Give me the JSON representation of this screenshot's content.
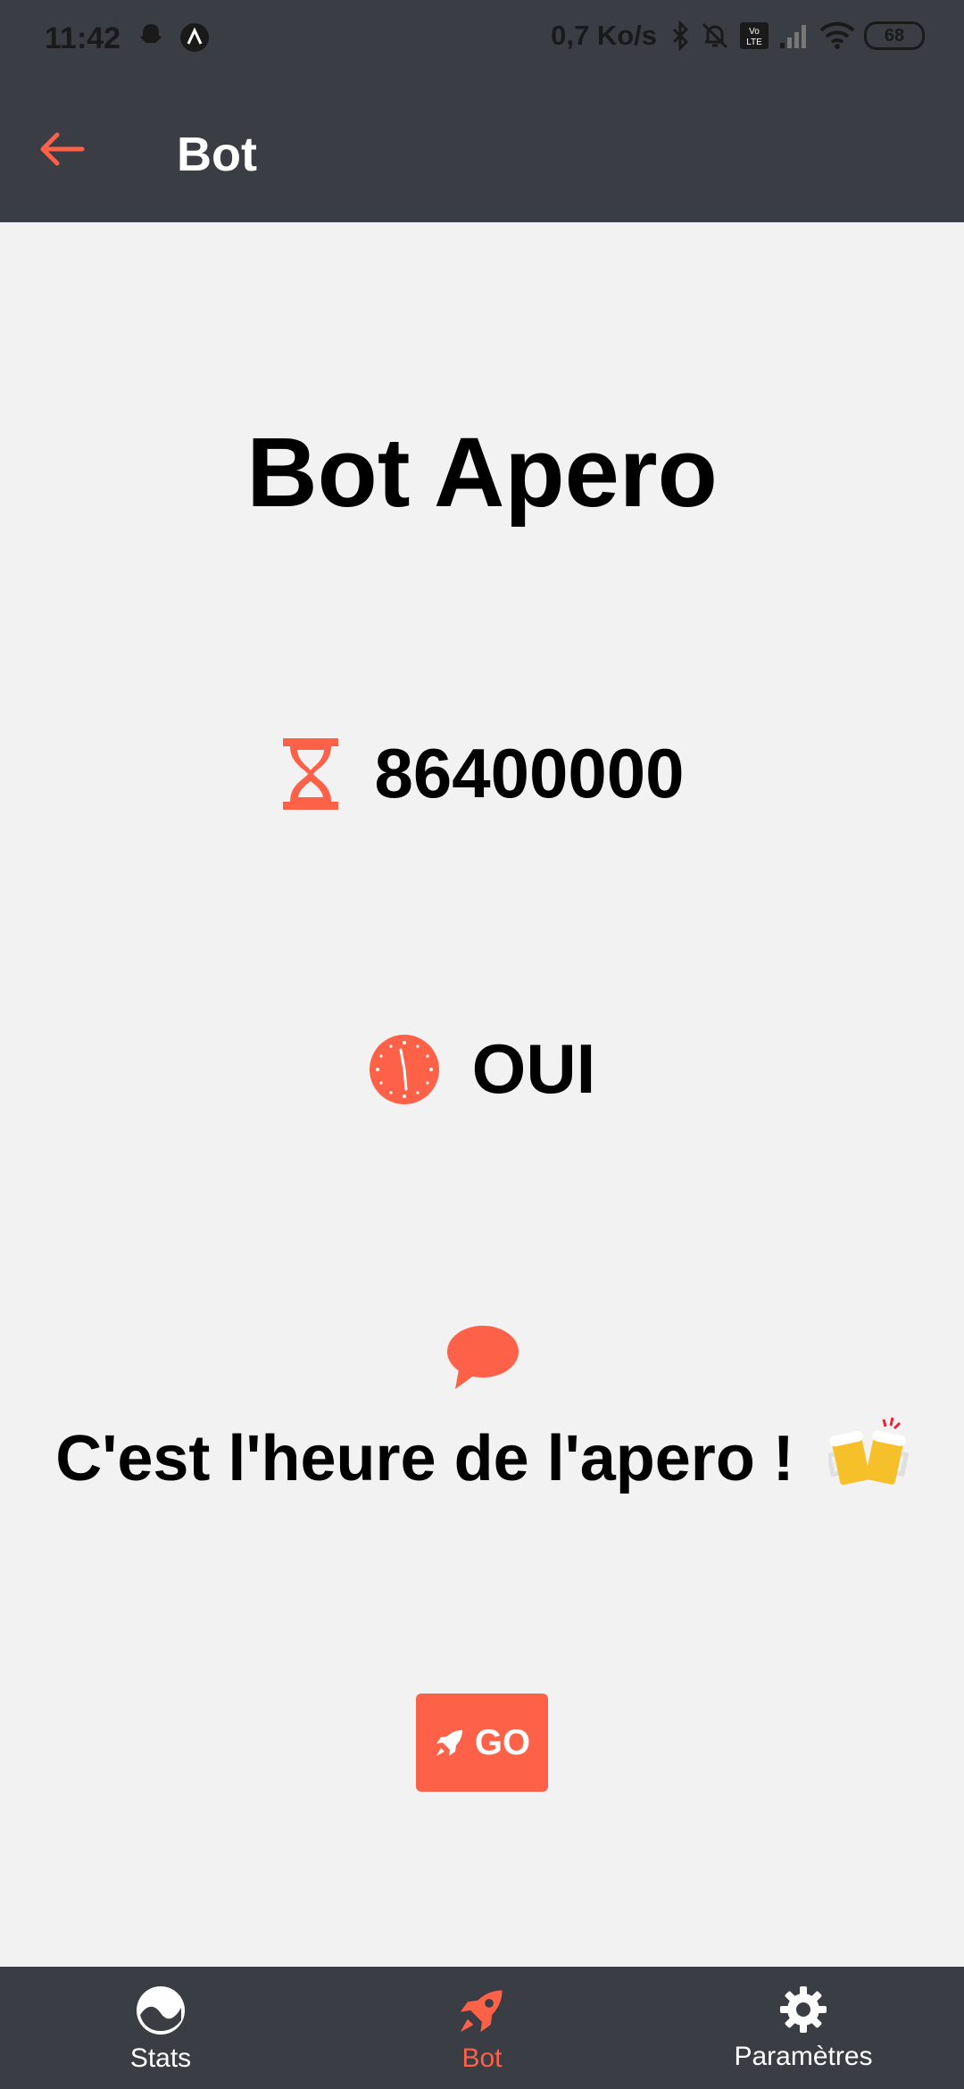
{
  "status_bar": {
    "time": "11:42",
    "speed": "0,7 Ko/s",
    "battery": "68"
  },
  "app_bar": {
    "title": "Bot"
  },
  "main": {
    "title": "Bot Apero",
    "timer_value": "86400000",
    "status_value": "OUI",
    "message": "C'est l'heure de l'apero !",
    "go_label": "GO"
  },
  "bottom_nav": {
    "items": [
      {
        "label": "Stats",
        "icon": "stats-icon"
      },
      {
        "label": "Bot",
        "icon": "rocket-icon",
        "active": true
      },
      {
        "label": "Paramètres",
        "icon": "gear-icon"
      }
    ]
  },
  "colors": {
    "accent": "#fd6148",
    "bar": "#3a3d44",
    "background": "#f2f2f2"
  }
}
